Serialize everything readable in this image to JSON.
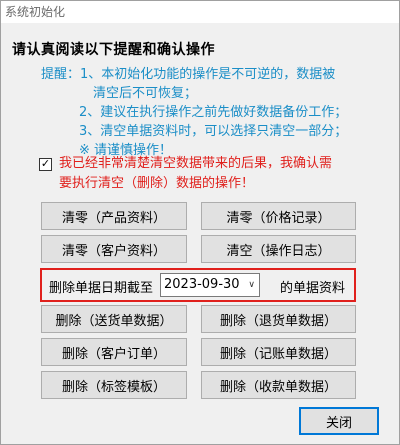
{
  "window": {
    "title": "系统初始化"
  },
  "heading": "请认真阅读以下提醒和确认操作",
  "warning": {
    "line1": "提醒：1、本初始化功能的操作是不可逆的，数据被",
    "line2": "清空后不可恢复；",
    "line3": "2、建议在执行操作之前先做好数据备份工作；",
    "line4": "3、清空单据资料时，可以选择只清空一部分；",
    "line5": "※ 请谨慎操作！"
  },
  "confirm": {
    "checked": true,
    "check_glyph": "✓",
    "line1": "我已经非常清楚清空数据带来的后果，我确认需",
    "line2": "要执行清空（删除）数据的操作！"
  },
  "buttons": {
    "clear_products": "清零（产品资料）",
    "clear_prices": "清零（价格记录）",
    "clear_customers": "清零（客户资料）",
    "clear_logs": "清空（操作日志）",
    "del_delivery": "删除（送货单数据）",
    "del_return": "删除（退货单数据）",
    "del_orders": "删除（客户订单）",
    "del_ledger": "删除（记账单数据）",
    "del_labels": "删除（标签模板）",
    "del_receipts": "删除（收款单数据）",
    "close": "关闭"
  },
  "date_row": {
    "prefix": "删除单据日期截至",
    "date": "2023-09-30",
    "suffix": "的单据资料"
  }
}
